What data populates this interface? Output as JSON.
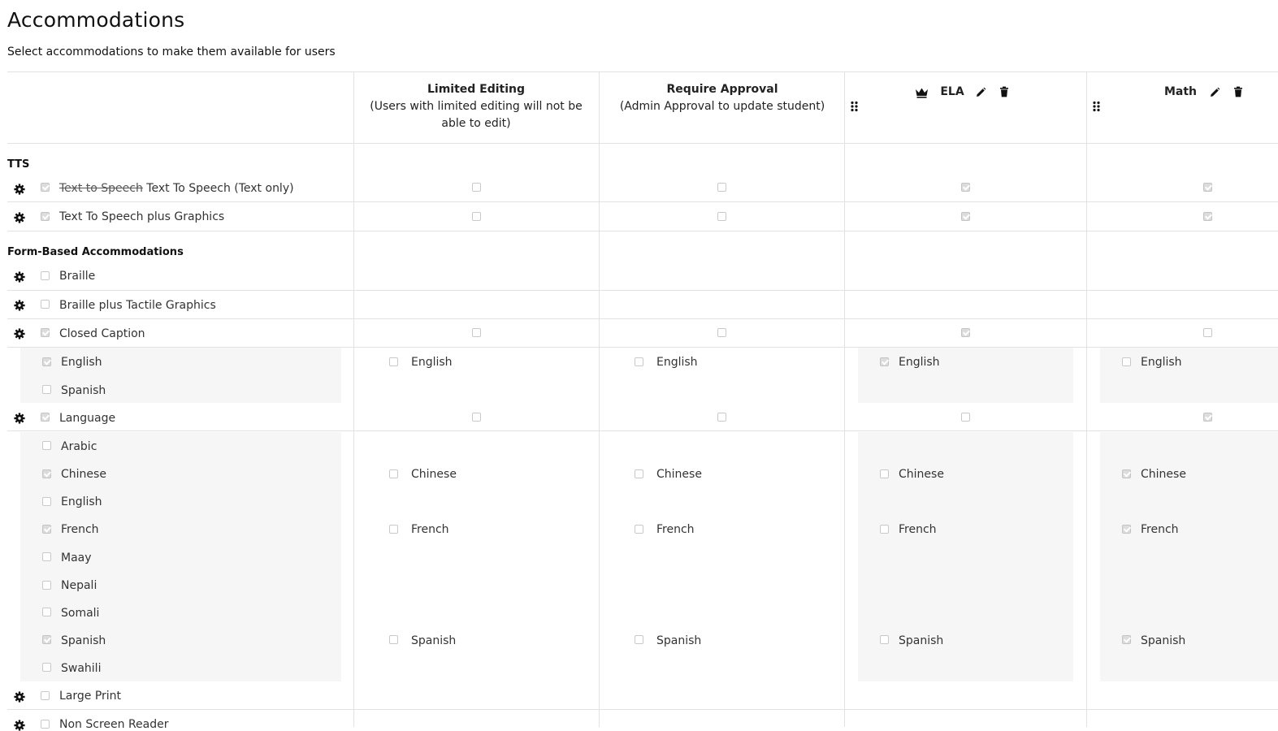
{
  "page": {
    "title": "Accommodations",
    "subtitle": "Select accommodations to make them available for users"
  },
  "columns": {
    "limited": {
      "title": "Limited Editing",
      "desc": "(Users with limited editing will not be able to edit)"
    },
    "approval": {
      "title": "Require Approval",
      "desc": "(Admin Approval to update student)"
    },
    "ela": {
      "title": "ELA"
    },
    "math": {
      "title": "Math"
    }
  },
  "sections": {
    "tts": "TTS",
    "form": "Form-Based Accommodations"
  },
  "rows": {
    "tts_text_only": {
      "strike_label": "Text to Speech",
      "label": "Text To Speech (Text only)"
    },
    "tts_graphics": {
      "label": "Text To Speech plus Graphics"
    },
    "braille": {
      "label": "Braille"
    },
    "braille_tactile": {
      "label": "Braille plus Tactile Graphics"
    },
    "closed_caption": {
      "label": "Closed Caption"
    },
    "language": {
      "label": "Language"
    },
    "large_print": {
      "label": "Large Print"
    },
    "non_screen_reader": {
      "label": "Non Screen Reader"
    }
  },
  "cc_options": {
    "english": "English",
    "spanish": "Spanish"
  },
  "lang_options": {
    "arabic": "Arabic",
    "chinese": "Chinese",
    "english": "English",
    "french": "French",
    "maay": "Maay",
    "nepali": "Nepali",
    "somali": "Somali",
    "spanish": "Spanish",
    "swahili": "Swahili"
  },
  "icons": [
    "gear-icon",
    "drag-handle-icon",
    "crown-icon",
    "pencil-icon",
    "trash-icon"
  ],
  "colors": {
    "checkbox_checked": "#dcdcdc",
    "shade": "#f6f6f6",
    "divider": "#e2e2e2"
  }
}
